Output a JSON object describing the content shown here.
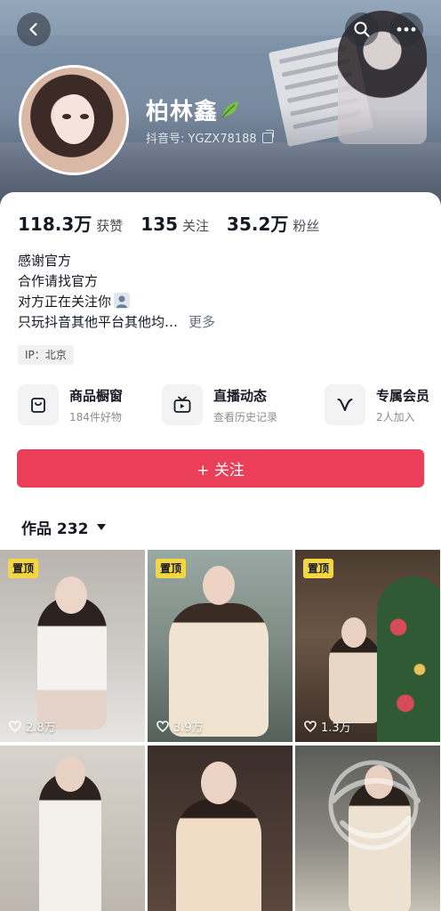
{
  "profile": {
    "nickname": "柏林鑫",
    "uid_label": "抖音号: YGZX78188"
  },
  "stats": [
    {
      "value": "118.3万",
      "label": "获赞"
    },
    {
      "value": "135",
      "label": "关注"
    },
    {
      "value": "35.2万",
      "label": "粉丝"
    }
  ],
  "bio": {
    "line1": "感谢官方",
    "line2": "合作请找官方",
    "line3": "对方正在关注你",
    "line4": "只玩抖音其他平台其他均…",
    "more": "更多"
  },
  "ip": "IP：北京",
  "services": [
    {
      "title": "商品橱窗",
      "sub": "184件好物",
      "icon": "shopping-bag-icon"
    },
    {
      "title": "直播动态",
      "sub": "查看历史记录",
      "icon": "live-tv-icon"
    },
    {
      "title": "专属会员",
      "sub": "2人加入",
      "icon": "member-v-icon"
    }
  ],
  "follow_button": "+ 关注",
  "works_tab": {
    "label": "作品 232"
  },
  "videos": [
    {
      "pinned": "置顶",
      "likes": "2.8万"
    },
    {
      "pinned": "置顶",
      "likes": "3.9万"
    },
    {
      "pinned": "置顶",
      "likes": "1.3万"
    },
    {
      "likes": ""
    },
    {
      "likes": ""
    },
    {
      "likes": ""
    }
  ],
  "colors": {
    "accent": "#ea3e59",
    "pin_badge": "#f4d641",
    "text_primary": "#161823",
    "text_secondary": "#8a8c92"
  }
}
